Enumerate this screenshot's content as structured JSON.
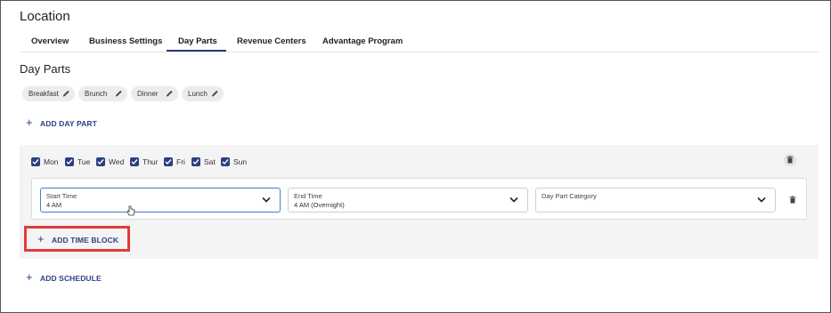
{
  "page": {
    "title": "Location"
  },
  "tabs": [
    {
      "label": "Overview",
      "active": false
    },
    {
      "label": "Business Settings",
      "active": false
    },
    {
      "label": "Day Parts",
      "active": true
    },
    {
      "label": "Revenue Centers",
      "active": false
    },
    {
      "label": "Advantage Program",
      "active": false
    }
  ],
  "day_parts": {
    "section_title": "Day Parts",
    "chips": [
      {
        "label": "Breakfast",
        "icon": "pencil-icon"
      },
      {
        "label": "Brunch",
        "icon": "pencil-icon"
      },
      {
        "label": "Dinner",
        "icon": "pencil-icon"
      },
      {
        "label": "Lunch",
        "icon": "pencil-icon"
      }
    ],
    "add_day_part_label": "ADD DAY PART"
  },
  "schedule": {
    "days": [
      {
        "label": "Mon",
        "checked": true
      },
      {
        "label": "Tue",
        "checked": true
      },
      {
        "label": "Wed",
        "checked": true
      },
      {
        "label": "Thur",
        "checked": true
      },
      {
        "label": "Fri",
        "checked": true
      },
      {
        "label": "Sat",
        "checked": true
      },
      {
        "label": "Sun",
        "checked": true
      }
    ],
    "time_block": {
      "start_time": {
        "label": "Start Time",
        "value": "4 AM"
      },
      "end_time": {
        "label": "End Time",
        "value": "4 AM (Overnight)"
      },
      "category": {
        "label": "Day Part Category",
        "value": ""
      }
    },
    "add_time_block_label": "ADD TIME BLOCK"
  },
  "add_schedule_label": "ADD SCHEDULE",
  "colors": {
    "accent": "#2c3f85",
    "highlight": "#e23a3a",
    "panel_bg": "#f4f4f4"
  }
}
